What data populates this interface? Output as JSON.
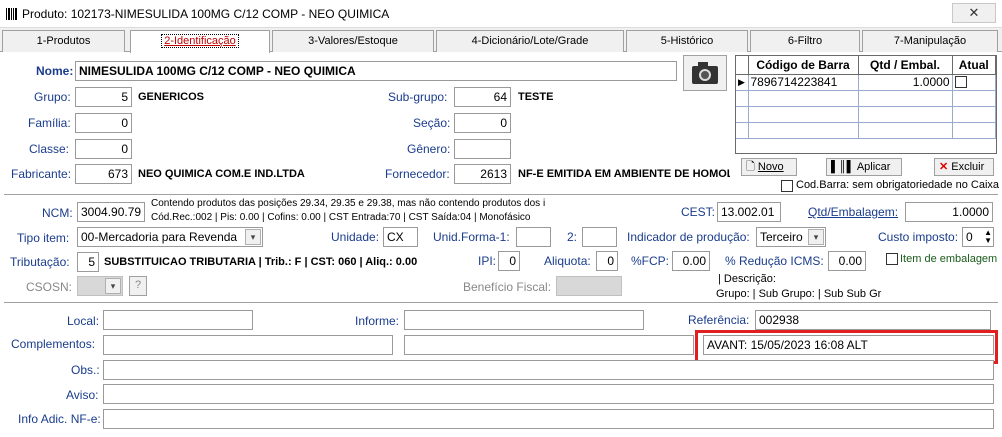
{
  "window": {
    "title": "Produto: 102173-NIMESULIDA 100MG C/12 COMP - NEO QUIMICA",
    "close": "✕"
  },
  "tabs": [
    {
      "label": "1-Produtos"
    },
    {
      "label": "2-Identificação"
    },
    {
      "label": "3-Valores/Estoque"
    },
    {
      "label": "4-Dicionário/Lote/Grade"
    },
    {
      "label": "5-Histórico"
    },
    {
      "label": "6-Filtro"
    },
    {
      "label": "7-Manipulação"
    }
  ],
  "form": {
    "nome_label": "Nome:",
    "nome": "NIMESULIDA 100MG C/12 COMP - NEO QUIMICA",
    "grupo_label": "Grupo:",
    "grupo": "5",
    "grupo_desc": "GENERICOS",
    "subgrupo_label": "Sub-grupo:",
    "subgrupo": "64",
    "subgrupo_desc": "TESTE",
    "familia_label": "Família:",
    "familia": "0",
    "secao_label": "Seção:",
    "secao": "0",
    "classe_label": "Classe:",
    "classe": "0",
    "genero_label": "Gênero:",
    "genero": "",
    "fabricante_label": "Fabricante:",
    "fabricante": "673",
    "fabricante_desc": "NEO QUIMICA COM.E IND.LTDA",
    "fornecedor_label": "Fornecedor:",
    "fornecedor": "2613",
    "fornecedor_desc": "NF-E EMITIDA EM AMBIENTE DE HOMOLOG"
  },
  "barcode": {
    "headers": [
      "Código de Barra",
      "Qtd / Embal.",
      "Atual"
    ],
    "rows": [
      {
        "code": "7896714223841",
        "qty": "1.0000"
      }
    ],
    "novo": "Novo",
    "aplicar": "Aplicar",
    "excluir": "Excluir",
    "cod_barra_opt": "Cod.Barra: sem obrigatoriedade no Caixa"
  },
  "fiscal": {
    "ncm_label": "NCM:",
    "ncm": "3004.90.79",
    "ncm_desc1": "Contendo produtos das posições 29.34, 29.35 e 29.38, mas não contendo produtos dos i",
    "ncm_desc2": "Cód.Rec.:002 | Pis: 0.00 | Cofins: 0.00 | CST Entrada:70 | CST Saída:04 | Monofásico",
    "cest_label": "CEST:",
    "cest": "13.002.01",
    "qtd_emb_label": "Qtd/Embalagem:",
    "qtd_emb": "1.0000",
    "tipo_item_label": "Tipo item:",
    "tipo_item": "00-Mercadoria para Revenda",
    "unidade_label": "Unidade:",
    "unidade": "CX",
    "unid_forma_label": "Unid.Forma-1:",
    "unid_forma": "",
    "dois_label": "2:",
    "dois": "",
    "ind_prod_label": "Indicador de produção:",
    "ind_prod": "Terceiro",
    "custo_label": "Custo imposto:",
    "custo": "0",
    "tributacao_label": "Tributação:",
    "tributacao": "5",
    "tributacao_desc": "SUBSTITUICAO TRIBUTARIA | Trib.: F | CST: 060 | Aliq.:   0.00",
    "ipi_label": "IPI:",
    "ipi": "0",
    "aliquota_label": "Aliquota:",
    "aliquota": "0",
    "fcp_label": "%FCP:",
    "fcp": "0.00",
    "red_icms_label": "% Redução ICMS:",
    "red_icms": "0.00",
    "item_emb_label": "Item de embalagem",
    "csosn_label": "CSOSN:",
    "csosn_q": "?",
    "beneficio_label": "Benefício Fiscal:",
    "desc_pipe": "| Descrição:",
    "grupo_line": "Grupo:  | Sub Grupo:   | Sub Sub Gr"
  },
  "extra": {
    "local_label": "Local:",
    "local": "",
    "informe_label": "Informe:",
    "informe": "",
    "referencia_label": "Referência:",
    "referencia": "002938",
    "complementos_label": "Complementos:",
    "avant": "AVANT: 15/05/2023 16:08 ALT",
    "obs_label": "Obs.:",
    "aviso_label": "Aviso:",
    "info_label": "Info Adic. NF-e:"
  },
  "colors": {
    "highlight": "#e02020",
    "label_blue": "#1a3c8c",
    "tab_active": "#c00000"
  }
}
